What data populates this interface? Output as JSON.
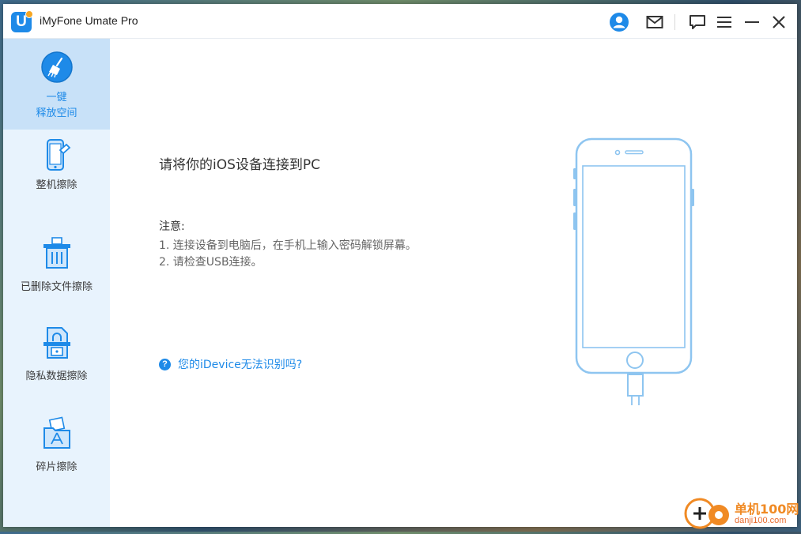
{
  "window": {
    "title": "iMyFone Umate Pro",
    "logo_letter": "U"
  },
  "titlebar": {
    "icons": [
      "user-account-icon",
      "mail-icon",
      "feedback-icon",
      "menu-icon",
      "minimize-icon",
      "close-icon"
    ]
  },
  "sidebar": {
    "items": [
      {
        "label_line1": "一键",
        "label_line2": "释放空间",
        "icon": "broom-icon",
        "active": true
      },
      {
        "label_line1": "整机擦除",
        "icon": "phone-erase-icon",
        "active": false
      },
      {
        "label_line1": "已删除文件擦除",
        "icon": "trash-icon",
        "active": false
      },
      {
        "label_line1": "隐私数据擦除",
        "icon": "lock-document-icon",
        "active": false
      },
      {
        "label_line1": "碎片擦除",
        "icon": "app-folder-icon",
        "active": false
      }
    ]
  },
  "main": {
    "heading": "请将你的iOS设备连接到PC",
    "note_title": "注意:",
    "notes": [
      "1. 连接设备到电脑后，在手机上输入密码解锁屏幕。",
      "2. 请检查USB连接。"
    ],
    "help_icon": "?",
    "help_link": "您的iDevice无法识别吗?"
  },
  "watermark": {
    "text1": "单机100网",
    "text2": "danji100.com"
  },
  "colors": {
    "accent": "#1e8ae8",
    "sidebar_bg": "#e8f3fd",
    "sidebar_active": "#c8e1f8",
    "phone_outline": "#8ec5f0"
  }
}
